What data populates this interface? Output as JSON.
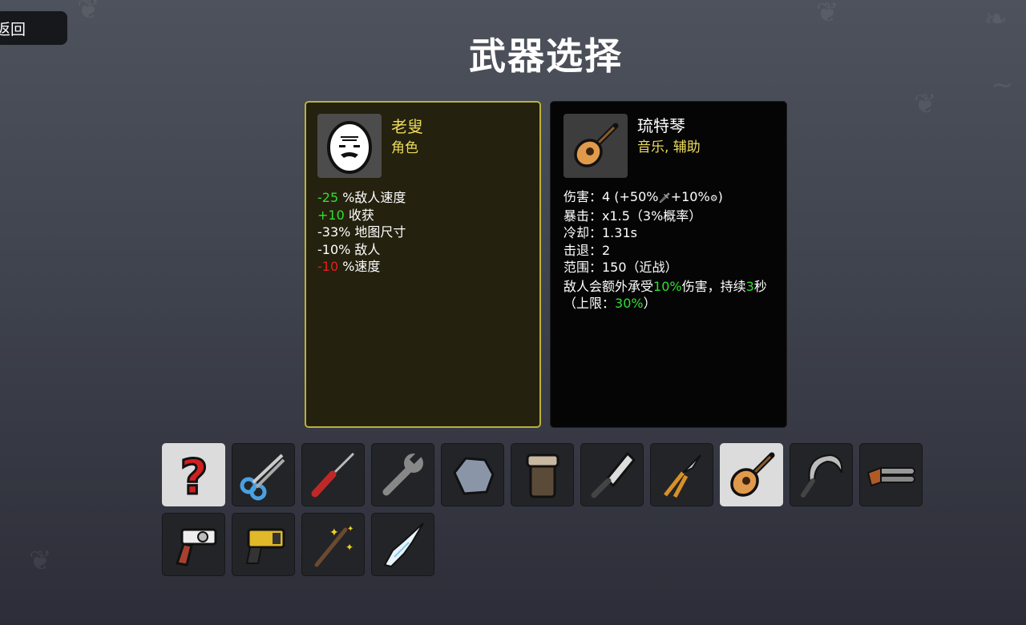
{
  "back_button": {
    "label": "返回"
  },
  "title": "武器选择",
  "character": {
    "name": "老叟",
    "type": "角色",
    "stats": [
      {
        "value": "-25",
        "color": "green",
        "text": " %敌人速度"
      },
      {
        "value": "+10",
        "color": "green",
        "text": " 收获"
      },
      {
        "value": "",
        "color": "",
        "text": "-33% 地图尺寸"
      },
      {
        "value": "",
        "color": "",
        "text": "-10% 敌人"
      },
      {
        "value": "-10",
        "color": "red",
        "text": " %速度"
      }
    ]
  },
  "weapon": {
    "name": "琉特琴",
    "type": "音乐, 辅助",
    "damage": "伤害：4 (+50%",
    "damage_mid": "+10%",
    "damage_end": ")",
    "crit": "暴击：x1.5（3%概率）",
    "cooldown": "冷却：1.31s",
    "knockback": "击退：2",
    "range": "范围：150（近战）",
    "effect_a": "敌人会额外承受",
    "effect_pct": "10%",
    "effect_b": "伤害，持续",
    "effect_sec": "3",
    "effect_c": "秒",
    "cap_a": "（上限：",
    "cap_pct": "30%",
    "cap_b": "）"
  },
  "weapon_slots": [
    {
      "icon": "random-question-icon",
      "selected": false,
      "light": true
    },
    {
      "icon": "scissors-icon",
      "selected": false,
      "light": false
    },
    {
      "icon": "screwdriver-icon",
      "selected": false,
      "light": false
    },
    {
      "icon": "wrench-icon",
      "selected": false,
      "light": false
    },
    {
      "icon": "rock-icon",
      "selected": false,
      "light": false
    },
    {
      "icon": "hand-icon",
      "selected": false,
      "light": false
    },
    {
      "icon": "cleaver-icon",
      "selected": false,
      "light": false
    },
    {
      "icon": "pruner-icon",
      "selected": false,
      "light": false
    },
    {
      "icon": "lute-icon",
      "selected": true,
      "light": true
    },
    {
      "icon": "sickle-icon",
      "selected": false,
      "light": false
    },
    {
      "icon": "shotgun-icon",
      "selected": false,
      "light": false
    },
    {
      "icon": "revolver-icon",
      "selected": false,
      "light": false
    },
    {
      "icon": "taser-icon",
      "selected": false,
      "light": false
    },
    {
      "icon": "magic-wand-icon",
      "selected": false,
      "light": false
    },
    {
      "icon": "icicle-icon",
      "selected": false,
      "light": false
    }
  ],
  "colors": {
    "accent": "#ecdb5a",
    "positive": "#2fe02f",
    "negative": "#e81d1d",
    "char_border": "#bcb136"
  }
}
